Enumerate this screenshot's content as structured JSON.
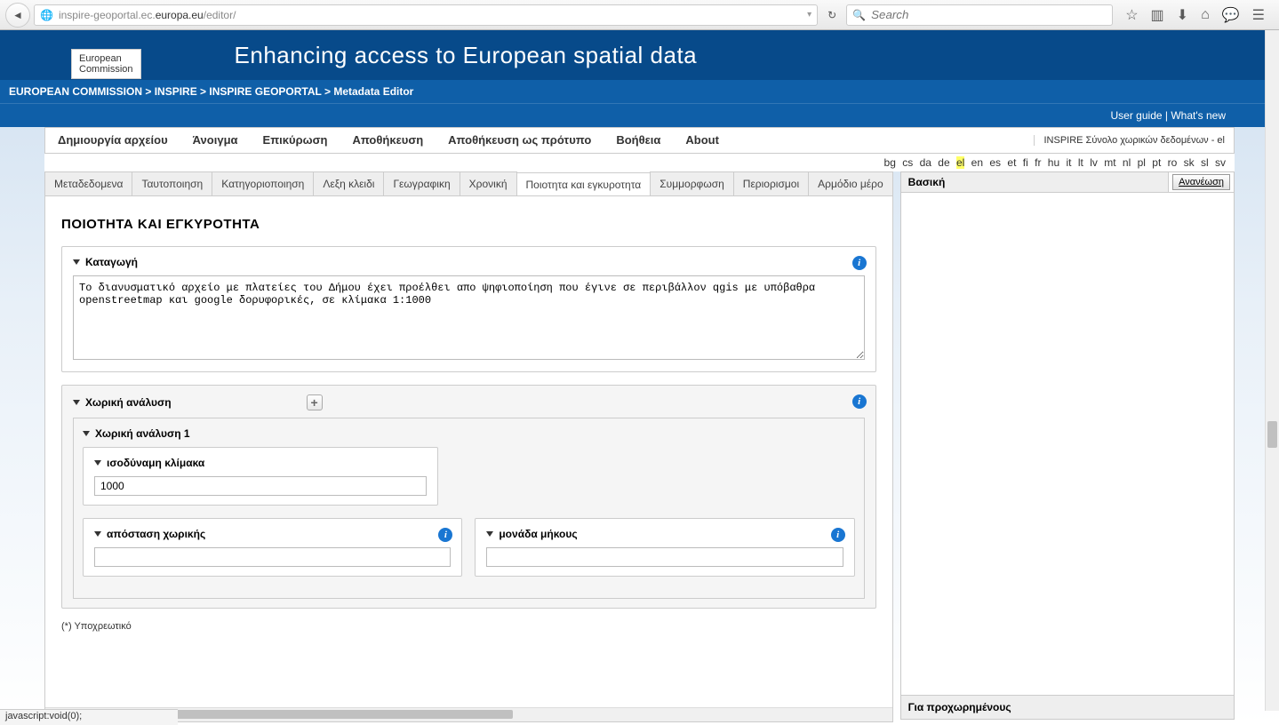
{
  "browser": {
    "url_prefix": "inspire-geoportal.ec.",
    "url_bold": "europa.eu",
    "url_suffix": "/editor/",
    "search_placeholder": "Search",
    "status_text": "javascript:void(0);"
  },
  "header": {
    "logo_line1": "European",
    "logo_line2": "Commission",
    "title": "Enhancing access to European spatial data"
  },
  "breadcrumb": {
    "items": [
      "EUROPEAN COMMISSION",
      "INSPIRE",
      "INSPIRE GEOPORTAL",
      "Metadata Editor"
    ],
    "sep": " > "
  },
  "toplinks": {
    "user_guide": "User guide",
    "whats_new": "What's new",
    "sep": " | "
  },
  "menu": {
    "items": [
      "Δημιουργία αρχείου",
      "Άνοιγμα",
      "Επικύρωση",
      "Αποθήκευση",
      "Αποθήκευση ως πρότυπο",
      "Βοήθεια",
      "About"
    ],
    "status": "INSPIRE Σύνολο χωρικών δεδομένων - el"
  },
  "languages": [
    "bg",
    "cs",
    "da",
    "de",
    "el",
    "en",
    "es",
    "et",
    "fi",
    "fr",
    "hu",
    "it",
    "lt",
    "lv",
    "mt",
    "nl",
    "pl",
    "pt",
    "ro",
    "sk",
    "sl",
    "sv"
  ],
  "active_language": "el",
  "tabs": [
    "Μεταδεδομενα",
    "Ταυτοποιηση",
    "Κατηγοριοποιηση",
    "Λεξη κλειδι",
    "Γεωγραφικη",
    "Χρονική",
    "Ποιοτητα και εγκυροτητα",
    "Συμμορφωση",
    "Περιορισμοι",
    "Αρμόδιο μέρο"
  ],
  "active_tab": 6,
  "content": {
    "heading": "ΠΟΙΟΤΗΤΑ ΚΑΙ ΕΓΚΥΡΟΤΗΤΑ",
    "lineage_label": "Καταγωγή",
    "lineage_value": "Το διανυσματικό αρχείο με πλατείες του Δήμου έχει προέλθει απο ψηφιοποίηση που έγινε σε περιβάλλον qgis με υπόβαθρα openstreetmap και google δορυφορικές, σε κλίμακα 1:1000",
    "spatial_label": "Χωρική ανάλυση",
    "spatial_item_label": "Χωρική ανάλυση 1",
    "scale_label": "ισοδύναμη κλίμακα",
    "scale_value": "1000",
    "distance_label": "απόσταση χωρικής",
    "distance_value": "",
    "unit_label": "μονάδα μήκους",
    "unit_value": "",
    "footnote": "(*) Υποχρεωτικό"
  },
  "right": {
    "basic": "Βασική",
    "refresh": "Ανανέωση",
    "advanced": "Για προχωρημένους"
  }
}
